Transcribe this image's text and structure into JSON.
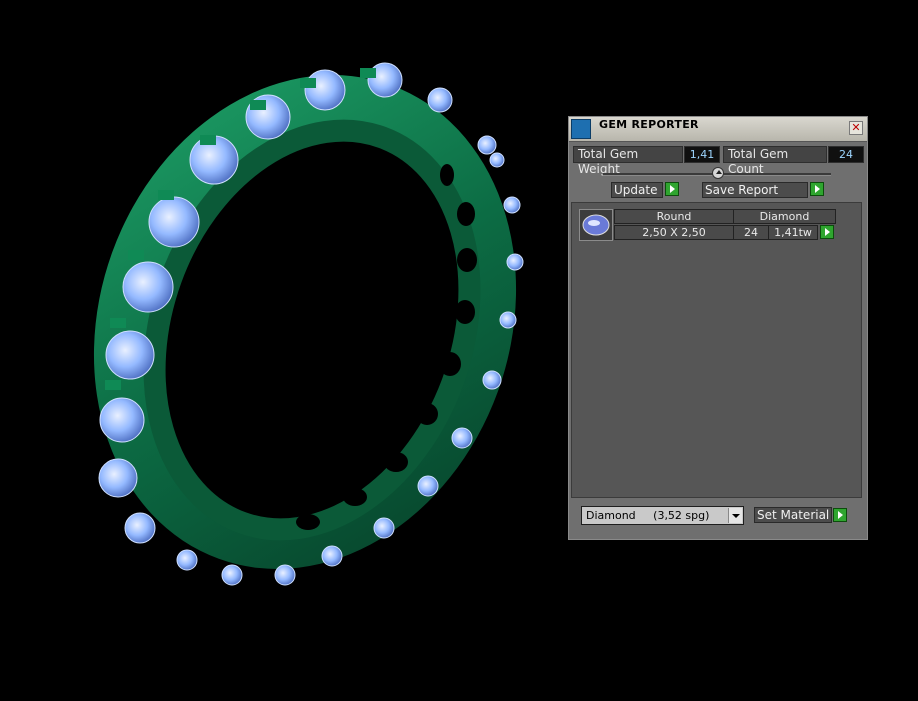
{
  "panel": {
    "title": "GEM REPORTER",
    "close_label": "✕",
    "total_weight_label": "Total Gem Weight",
    "total_weight_value": "1,41",
    "total_count_label": "Total Gem Count",
    "total_count_value": "24",
    "update_label": "Update",
    "save_report_label": "Save Report",
    "gems": [
      {
        "shape": "Round",
        "material": "Diamond",
        "size": "2,50 X 2,50",
        "count": "24",
        "weight": "1,41tw"
      }
    ],
    "material_select_value": "Diamond     (3,52 spg)",
    "set_material_label": "Set Material"
  },
  "colors": {
    "ring_metal": "#0d7a4e",
    "gem": "#86b0ff",
    "panel_bg": "#6f6f6f",
    "accent_green": "#2fa52f"
  }
}
